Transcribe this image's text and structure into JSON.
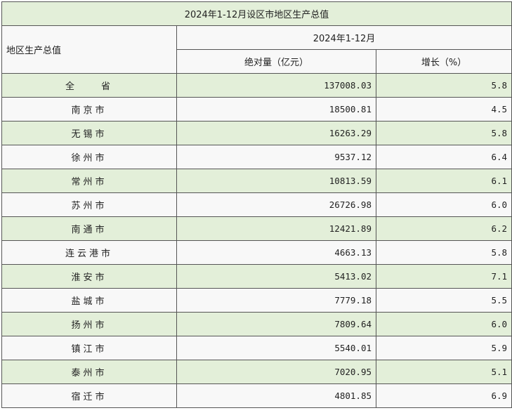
{
  "table": {
    "title": "2024年1-12月设区市地区生产总值",
    "row_header": "地区生产总值",
    "period": "2024年1-12月",
    "col_value": "绝对量（亿元）",
    "col_growth": "增长（%）",
    "rows": [
      {
        "region": "全　　省",
        "value": "137008.03",
        "growth": "5.8"
      },
      {
        "region": "南京市",
        "value": "18500.81",
        "growth": "4.5"
      },
      {
        "region": "无锡市",
        "value": "16263.29",
        "growth": "5.8"
      },
      {
        "region": "徐州市",
        "value": "9537.12",
        "growth": "6.4"
      },
      {
        "region": "常州市",
        "value": "10813.59",
        "growth": "6.1"
      },
      {
        "region": "苏州市",
        "value": "26726.98",
        "growth": "6.0"
      },
      {
        "region": "南通市",
        "value": "12421.89",
        "growth": "6.2"
      },
      {
        "region": "连云港市",
        "value": "4663.13",
        "growth": "5.8"
      },
      {
        "region": "淮安市",
        "value": "5413.02",
        "growth": "7.1"
      },
      {
        "region": "盐城市",
        "value": "7779.18",
        "growth": "5.5"
      },
      {
        "region": "扬州市",
        "value": "7809.64",
        "growth": "6.0"
      },
      {
        "region": "镇江市",
        "value": "5540.01",
        "growth": "5.9"
      },
      {
        "region": "泰州市",
        "value": "7020.95",
        "growth": "5.1"
      },
      {
        "region": "宿迁市",
        "value": "4801.85",
        "growth": "6.9"
      }
    ]
  }
}
